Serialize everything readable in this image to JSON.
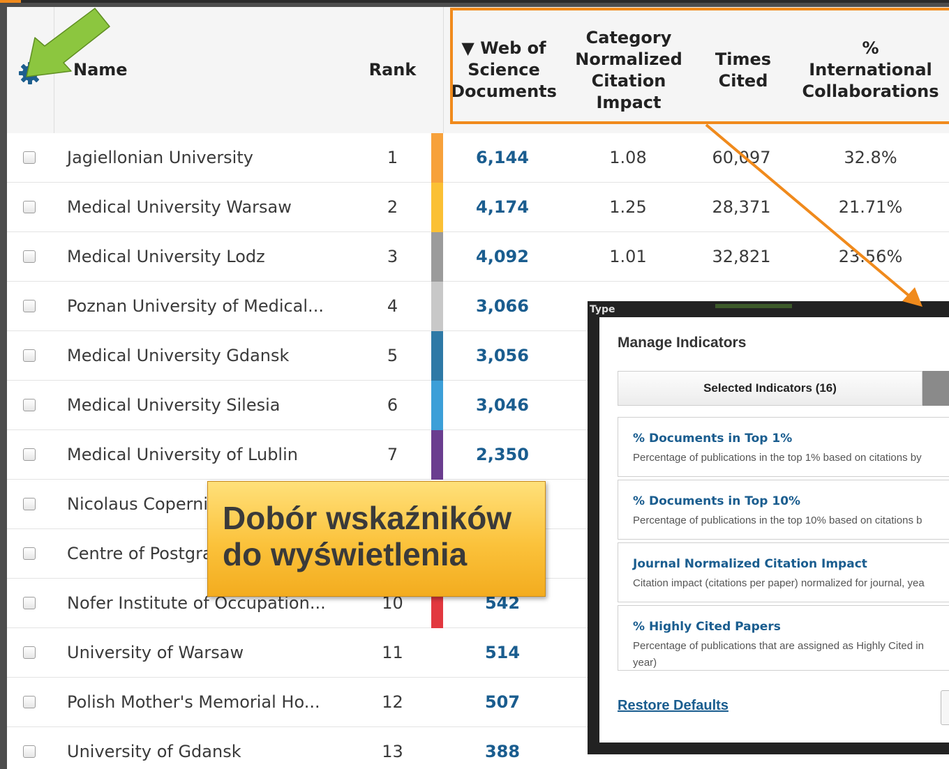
{
  "table": {
    "columns": {
      "name": "Name",
      "rank": "Rank",
      "wos": "▼ Web of Science Documents",
      "cnci": "Category Normalized Citation Impact",
      "times_cited": "Times Cited",
      "intl": "% International Collaborations"
    },
    "rows": [
      {
        "name": "Jagiellonian University",
        "rank": "1",
        "wos": "6,144",
        "cnci": "1.08",
        "times_cited": "60,097",
        "intl": "32.8%",
        "color": "#f7a13b"
      },
      {
        "name": "Medical University Warsaw",
        "rank": "2",
        "wos": "4,174",
        "cnci": "1.25",
        "times_cited": "28,371",
        "intl": "21.71%",
        "color": "#fbc034"
      },
      {
        "name": "Medical University Lodz",
        "rank": "3",
        "wos": "4,092",
        "cnci": "1.01",
        "times_cited": "32,821",
        "intl": "23.56%",
        "color": "#9b9b9b"
      },
      {
        "name": "Poznan University of Medical...",
        "rank": "4",
        "wos": "3,066",
        "cnci": "",
        "times_cited": "",
        "intl": "",
        "color": "#c8c8c8"
      },
      {
        "name": "Medical University Gdansk",
        "rank": "5",
        "wos": "3,056",
        "cnci": "",
        "times_cited": "",
        "intl": "",
        "color": "#2e79a6"
      },
      {
        "name": "Medical University Silesia",
        "rank": "6",
        "wos": "3,046",
        "cnci": "",
        "times_cited": "",
        "intl": "",
        "color": "#3c9fd8"
      },
      {
        "name": "Medical University of Lublin",
        "rank": "7",
        "wos": "2,350",
        "cnci": "",
        "times_cited": "",
        "intl": "",
        "color": "#6a3d8f"
      },
      {
        "name": "Nicolaus Coperni",
        "rank": "",
        "wos": "",
        "cnci": "",
        "times_cited": "",
        "intl": "",
        "color": ""
      },
      {
        "name": "Centre of Postgra",
        "rank": "",
        "wos": "",
        "cnci": "",
        "times_cited": "",
        "intl": "",
        "color": ""
      },
      {
        "name": "Nofer Institute of Occupation...",
        "rank": "10",
        "wos": "542",
        "cnci": "",
        "times_cited": "",
        "intl": "",
        "color": "#e2383f"
      },
      {
        "name": "University of Warsaw",
        "rank": "11",
        "wos": "514",
        "cnci": "",
        "times_cited": "",
        "intl": "",
        "color": ""
      },
      {
        "name": "Polish Mother's Memorial Ho...",
        "rank": "12",
        "wos": "507",
        "cnci": "",
        "times_cited": "",
        "intl": "",
        "color": ""
      },
      {
        "name": "University of Gdansk",
        "rank": "13",
        "wos": "388",
        "cnci": "",
        "times_cited": "",
        "intl": "",
        "color": ""
      }
    ]
  },
  "callout": {
    "line1": "Dobór wskaźników",
    "line2": "do wyświetlenia"
  },
  "dialog": {
    "title": "Manage Indicators",
    "selected_tab": "Selected Indicators (16)",
    "indicators": [
      {
        "title": "% Documents in Top 1%",
        "desc": "Percentage of publications in the top 1% based on citations by",
        "desc2": ""
      },
      {
        "title": "% Documents in Top 10%",
        "desc": "Percentage of publications in the top 10% based on citations b",
        "desc2": ""
      },
      {
        "title": "Journal Normalized Citation Impact",
        "desc": "Citation impact (citations per paper) normalized for journal, yea",
        "desc2": ""
      },
      {
        "title": "% Highly Cited Papers",
        "desc": "Percentage of publications that are assigned as Highly Cited in",
        "desc2": "year)"
      }
    ],
    "restore_label": "Restore Defaults",
    "behind_label": "Type"
  },
  "colors": {
    "accent": "#f08a1c",
    "link": "#1a5d8f",
    "callout_bg": "#fbc23b",
    "green_arrow": "#8cc63f"
  },
  "icons": {
    "settings": "gear-icon",
    "pointer": "green-arrow-icon"
  }
}
